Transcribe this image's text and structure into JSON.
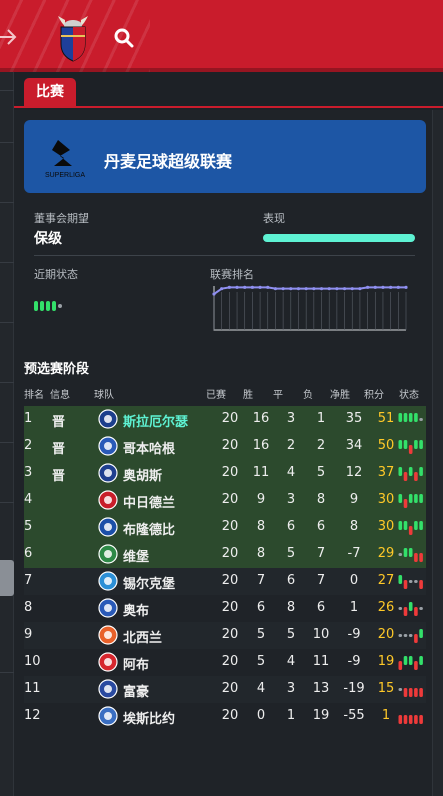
{
  "header": {
    "back_icon": "arrow-right-icon",
    "crest_icon": "club-crest-icon",
    "search_icon": "search-icon"
  },
  "tabs": [
    {
      "label": "比赛",
      "active": true
    }
  ],
  "league": {
    "name": "丹麦足球超级联赛",
    "logo_text": "SUPERLIGA"
  },
  "board": {
    "expectation_label": "董事会期望",
    "expectation_value": "保级",
    "performance_label": "表现",
    "performance_fraction": 1.0
  },
  "recent_form": {
    "label": "近期状态",
    "results": [
      "W",
      "W",
      "W",
      "W",
      "D"
    ]
  },
  "league_rank": {
    "label": "联赛排名",
    "positions": [
      6,
      2,
      1,
      1,
      1,
      1,
      1,
      1,
      2,
      2,
      2,
      2,
      2,
      2,
      2,
      2,
      2,
      2,
      2,
      2,
      1,
      1,
      1,
      1,
      1,
      1
    ]
  },
  "table": {
    "title": "预选赛阶段",
    "headers": {
      "rank": "排名",
      "info": "信息",
      "team": "球队",
      "played": "已赛",
      "won": "胜",
      "drawn": "平",
      "lost": "负",
      "gd": "净胜",
      "points": "积分",
      "form": "状态"
    },
    "rows": [
      {
        "rank": "1",
        "info": "晋",
        "team": "斯拉厄尔瑟",
        "p": "20",
        "w": "16",
        "d": "3",
        "l": "1",
        "gd": "35",
        "pts": "51",
        "form": [
          "W",
          "W",
          "W",
          "W",
          "D"
        ],
        "color": "#1c3f8c",
        "highlight": true
      },
      {
        "rank": "2",
        "info": "晋",
        "team": "哥本哈根",
        "p": "20",
        "w": "16",
        "d": "2",
        "l": "2",
        "gd": "34",
        "pts": "50",
        "form": [
          "W",
          "W",
          "L",
          "W",
          "W"
        ],
        "color": "#2a5ab8"
      },
      {
        "rank": "3",
        "info": "晋",
        "team": "奥胡斯",
        "p": "20",
        "w": "11",
        "d": "4",
        "l": "5",
        "gd": "12",
        "pts": "37",
        "form": [
          "W",
          "L",
          "W",
          "L",
          "W"
        ],
        "color": "#1f3f8f"
      },
      {
        "rank": "4",
        "info": "",
        "team": "中日德兰",
        "p": "20",
        "w": "9",
        "d": "3",
        "l": "8",
        "gd": "9",
        "pts": "30",
        "form": [
          "W",
          "L",
          "W",
          "W",
          "W"
        ],
        "color": "#c81e2a"
      },
      {
        "rank": "5",
        "info": "",
        "team": "布隆德比",
        "p": "20",
        "w": "8",
        "d": "6",
        "l": "6",
        "gd": "8",
        "pts": "30",
        "form": [
          "W",
          "W",
          "L",
          "W",
          "W"
        ],
        "color": "#1b4fa8"
      },
      {
        "rank": "6",
        "info": "",
        "team": "维堡",
        "p": "20",
        "w": "8",
        "d": "5",
        "l": "7",
        "gd": "-7",
        "pts": "29",
        "form": [
          "D",
          "W",
          "W",
          "L",
          "L"
        ],
        "color": "#2e8a47"
      },
      {
        "rank": "7",
        "info": "",
        "team": "锡尔克堡",
        "p": "20",
        "w": "7",
        "d": "6",
        "l": "7",
        "gd": "0",
        "pts": "27",
        "form": [
          "W",
          "L",
          "D",
          "D",
          "L"
        ],
        "color": "#2b8fd6"
      },
      {
        "rank": "8",
        "info": "",
        "team": "奥布",
        "p": "20",
        "w": "6",
        "d": "8",
        "l": "6",
        "gd": "1",
        "pts": "26",
        "form": [
          "D",
          "L",
          "W",
          "L",
          "D"
        ],
        "color": "#2a5ab8"
      },
      {
        "rank": "9",
        "info": "",
        "team": "北西兰",
        "p": "20",
        "w": "5",
        "d": "5",
        "l": "10",
        "gd": "-9",
        "pts": "20",
        "form": [
          "D",
          "D",
          "D",
          "L",
          "W"
        ],
        "color": "#e8612a"
      },
      {
        "rank": "10",
        "info": "",
        "team": "阿布",
        "p": "20",
        "w": "5",
        "d": "4",
        "l": "11",
        "gd": "-9",
        "pts": "19",
        "form": [
          "L",
          "W",
          "W",
          "L",
          "W"
        ],
        "color": "#d6262e"
      },
      {
        "rank": "11",
        "info": "",
        "team": "富豪",
        "p": "20",
        "w": "4",
        "d": "3",
        "l": "13",
        "gd": "-19",
        "pts": "15",
        "form": [
          "D",
          "L",
          "L",
          "L",
          "L"
        ],
        "color": "#2a4aa0"
      },
      {
        "rank": "12",
        "info": "",
        "team": "埃斯比约",
        "p": "20",
        "w": "0",
        "d": "1",
        "l": "19",
        "gd": "-55",
        "pts": "1",
        "form": [
          "L",
          "L",
          "L",
          "L",
          "L"
        ],
        "color": "#3a6ec2"
      }
    ]
  },
  "colors": {
    "accent": "#c91c2c",
    "win": "#33e06a",
    "draw": "#9aa0a6",
    "loss": "#ee3a3a",
    "points": "#ffc928",
    "highlight": "#5ef2d3"
  }
}
